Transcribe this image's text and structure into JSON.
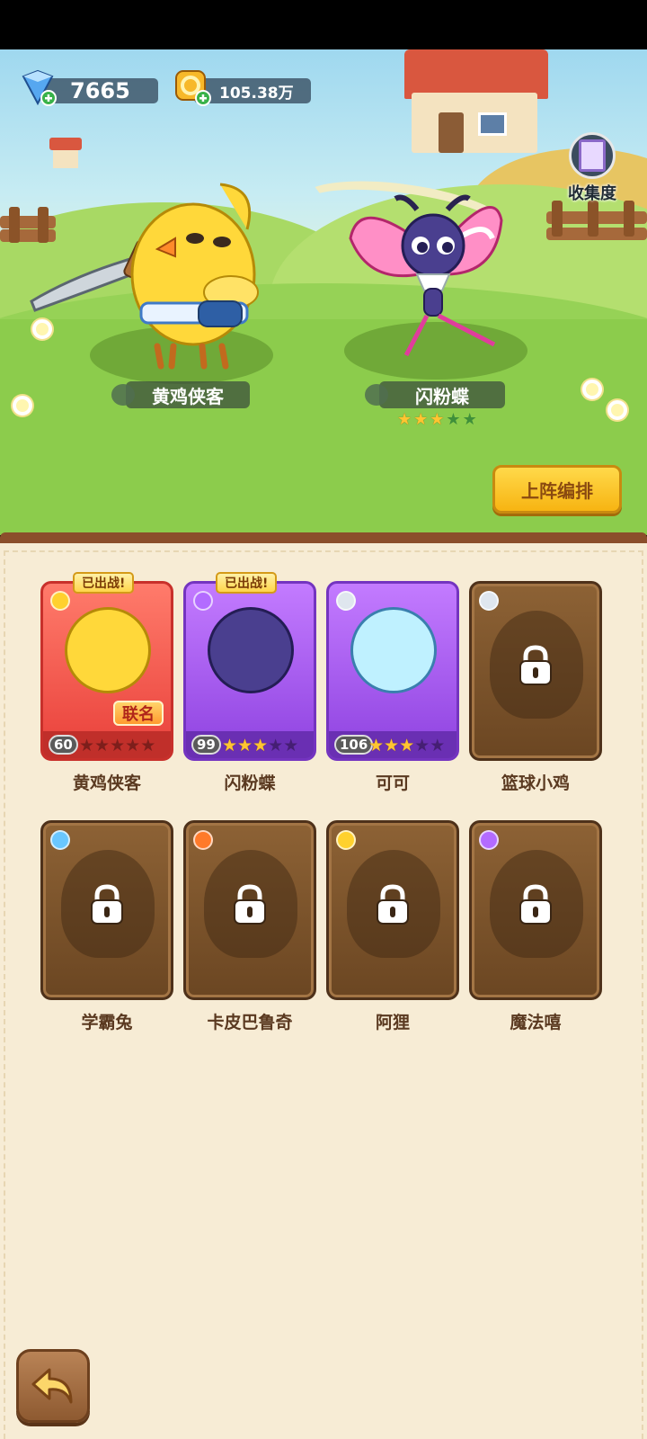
{
  "currency": {
    "gems": "7665",
    "coins": "105.38万"
  },
  "collection_label": "收集度",
  "scene": {
    "hero_left": {
      "name": "黄鸡侠客"
    },
    "hero_right": {
      "name": "闪粉蝶",
      "stars": 3,
      "max_stars": 5
    }
  },
  "deploy_button": "上阵编排",
  "deployed_badge": "已出战!",
  "collab_tag": "联名",
  "cards": [
    {
      "name": "黄鸡侠客",
      "level": "60",
      "stars": 0,
      "rarity": "red",
      "element": "lightning",
      "deployed": true,
      "collab": true,
      "locked": false
    },
    {
      "name": "闪粉蝶",
      "level": "99",
      "stars": 3,
      "rarity": "purple",
      "element": "potion",
      "deployed": true,
      "collab": false,
      "locked": false
    },
    {
      "name": "可可",
      "level": "106",
      "stars": 3,
      "rarity": "purple",
      "element": "sword",
      "deployed": false,
      "collab": false,
      "locked": false
    },
    {
      "name": "篮球小鸡",
      "locked": true,
      "element": "sword"
    },
    {
      "name": "学霸兔",
      "locked": true,
      "element": "water"
    },
    {
      "name": "卡皮巴鲁奇",
      "locked": true,
      "element": "fire"
    },
    {
      "name": "阿狸",
      "locked": true,
      "element": "lightning"
    },
    {
      "name": "魔法嘻",
      "locked": true,
      "element": "potion"
    }
  ],
  "colors": {
    "panel_bg": "#f7ecd5",
    "deploy_button": "#ffc72e",
    "name_text": "#5a3920"
  },
  "icons": {
    "back": "back-arrow-icon",
    "gem": "gem-icon",
    "coin": "coin-icon",
    "collection": "book-icon",
    "lock": "lock-icon"
  }
}
